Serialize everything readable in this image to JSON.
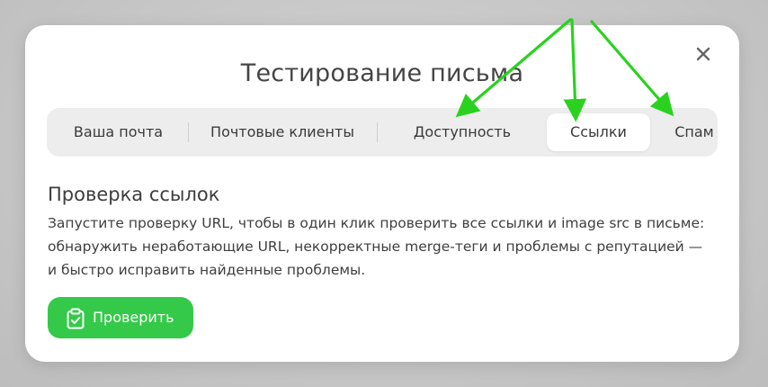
{
  "dialog": {
    "title": "Тестирование письма",
    "close_icon": "close-icon"
  },
  "tabs": [
    {
      "label": "Ваша почта",
      "active": false
    },
    {
      "label": "Почтовые клиенты",
      "active": false
    },
    {
      "label": "Доступность",
      "active": false
    },
    {
      "label": "Ссылки",
      "active": true
    },
    {
      "label": "Спам",
      "active": false
    }
  ],
  "section": {
    "title": "Проверка ссылок",
    "description": "Запустите проверку URL, чтобы в один клик проверить все ссылки и image src в письме: обнаружить неработающие URL, некорректные merge-теги и проблемы с репутацией — и быстро исправить найденные проблемы."
  },
  "action": {
    "label": "Проверить",
    "icon": "clipboard-check-icon",
    "color": "#35c94a"
  },
  "annotation": {
    "arrow_color": "#2ad21f"
  }
}
